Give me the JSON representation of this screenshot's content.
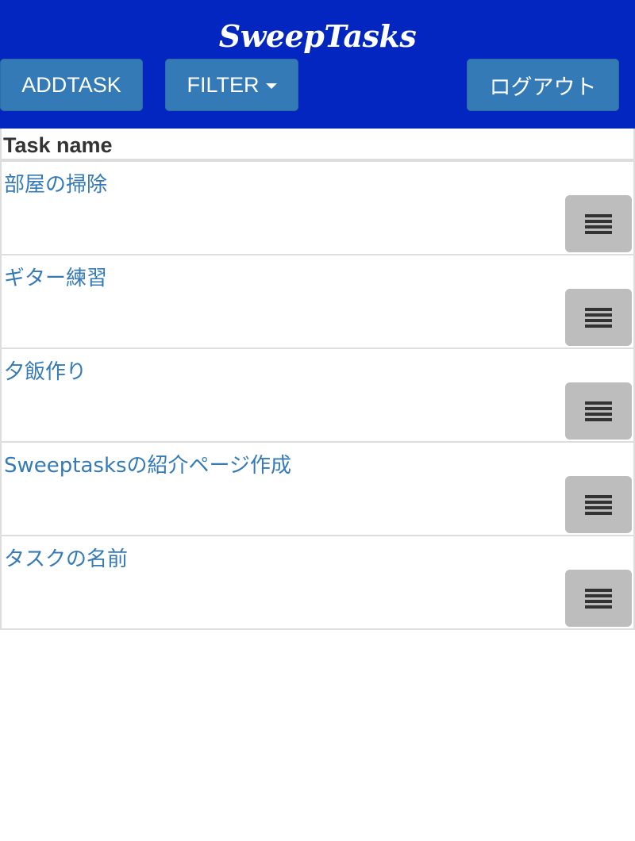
{
  "app": {
    "brand": "SweepTasks"
  },
  "navbar": {
    "add_task_label": "ADDTASK",
    "filter_label": "FILTER",
    "logout_label": "ログアウト",
    "background": "#0226bf",
    "button_color": "#337ab7"
  },
  "table": {
    "header": "Task name",
    "tasks": [
      {
        "name": "部屋の掃除"
      },
      {
        "name": "ギター練習"
      },
      {
        "name": "夕飯作り"
      },
      {
        "name": "Sweeptasksの紹介ページ作成"
      },
      {
        "name": "タスクの名前"
      }
    ],
    "row_menu_icon": "hamburger-menu-icon",
    "link_color": "#337ab7"
  }
}
